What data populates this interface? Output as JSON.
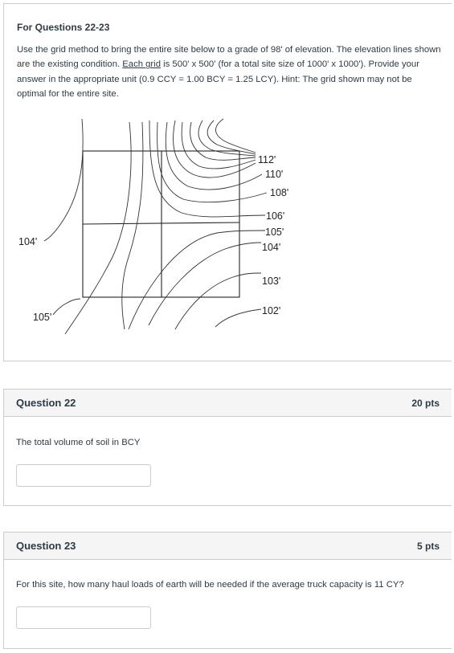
{
  "intro": {
    "title": "For Questions 22-23",
    "text_part1": "Use the grid method to bring the entire site below to a grade of 98' of elevation.  The elevation lines shown are the existing condition.  ",
    "text_underlined": "Each grid",
    "text_part2": " is 500' x 500' (for a total site size of 1000' x 1000').  Provide your answer in the appropriate unit (0.9 CCY = 1.00 BCY = 1.25 LCY).  Hint:  The grid shown may not be optimal for the entire site."
  },
  "contour_labels": {
    "l112": "112'",
    "l110": "110'",
    "l108": "108'",
    "l106": "106'",
    "l105r": "105'",
    "l104r": "104'",
    "l103": "103'",
    "l102": "102'",
    "l104l": "104'",
    "l105l": "105'"
  },
  "questions": [
    {
      "title": "Question 22",
      "points": "20 pts",
      "text": "The total volume of soil in BCY",
      "answer_value": ""
    },
    {
      "title": "Question 23",
      "points": "5 pts",
      "text": "For this site, how many haul loads of earth will be needed if the average truck capacity is 11 CY?",
      "answer_value": ""
    }
  ]
}
